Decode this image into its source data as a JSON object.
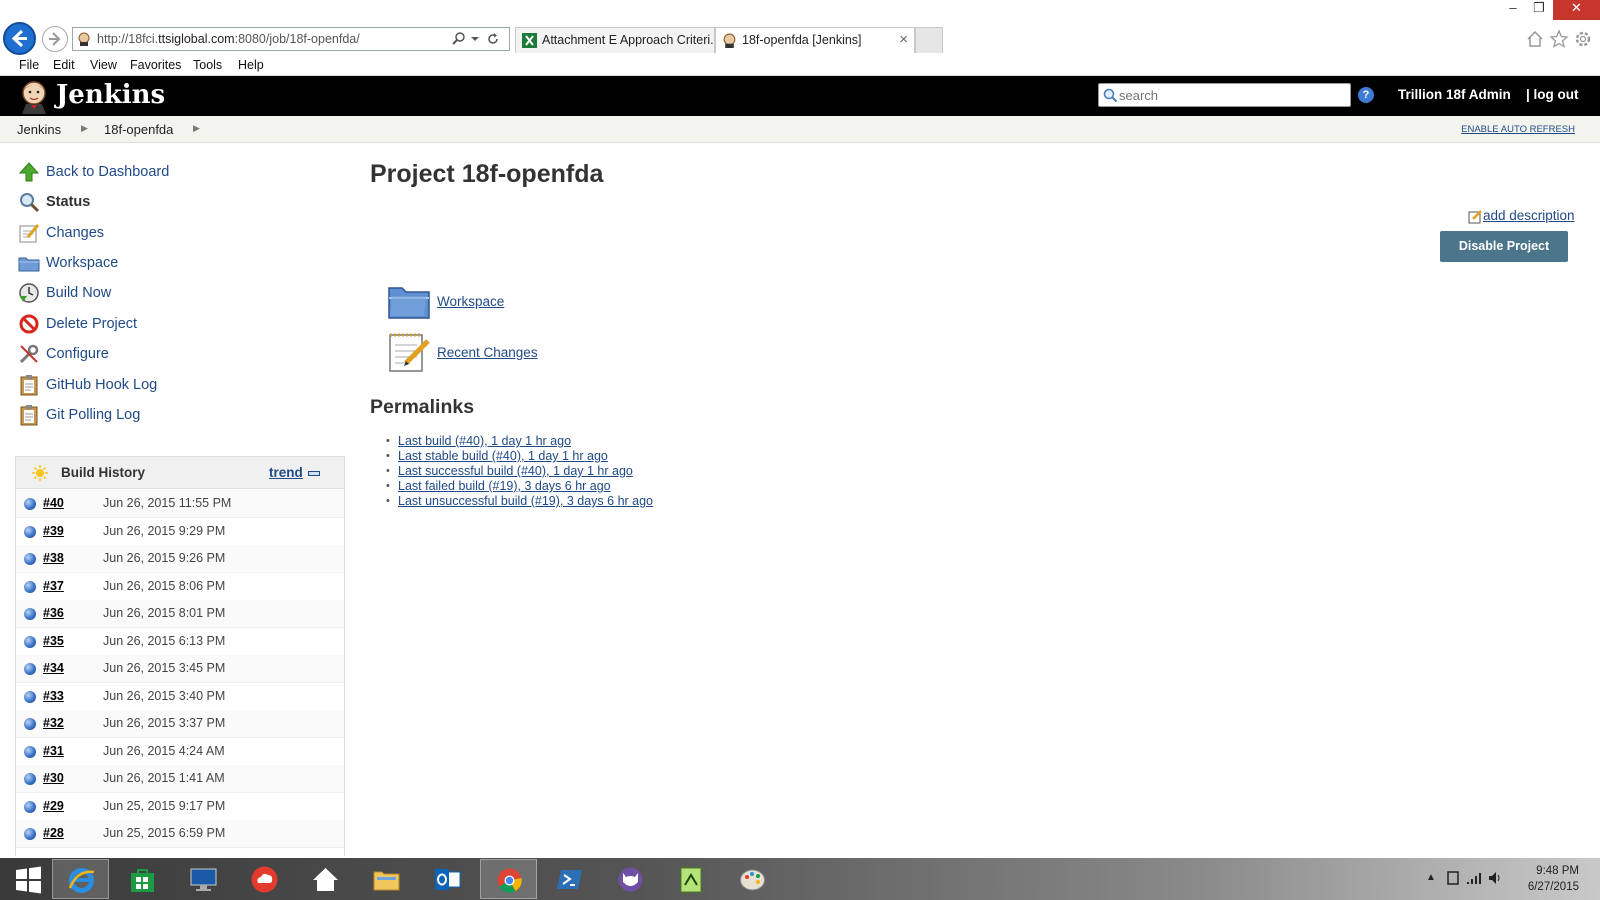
{
  "browser": {
    "url_prefix": "http://18fci.",
    "url_domain": "ttsiglobal.com",
    "url_suffix": ":8080/job/18f-openfda/",
    "tabs": [
      {
        "label": "Attachment E Approach Criteri..."
      },
      {
        "label": "18f-openfda [Jenkins]"
      }
    ],
    "menu": [
      "File",
      "Edit",
      "View",
      "Favorites",
      "Tools",
      "Help"
    ]
  },
  "header": {
    "logo_text": "Jenkins",
    "search_placeholder": "search",
    "user": "Trillion 18f Admin",
    "logout": "| log out"
  },
  "breadcrumb": {
    "items": [
      "Jenkins",
      "18f-openfda"
    ],
    "auto_refresh": "ENABLE AUTO REFRESH"
  },
  "sidebar": {
    "tasks": [
      {
        "label": "Back to Dashboard",
        "icon": "up-arrow-icon"
      },
      {
        "label": "Status",
        "icon": "magnifier-icon"
      },
      {
        "label": "Changes",
        "icon": "notepad-icon"
      },
      {
        "label": "Workspace",
        "icon": "folder-icon"
      },
      {
        "label": "Build Now",
        "icon": "clock-icon"
      },
      {
        "label": "Delete Project",
        "icon": "no-entry-icon"
      },
      {
        "label": "Configure",
        "icon": "wrench-icon"
      },
      {
        "label": "GitHub Hook Log",
        "icon": "clipboard-icon"
      },
      {
        "label": "Git Polling Log",
        "icon": "clipboard-icon"
      }
    ]
  },
  "build_history": {
    "title": "Build History",
    "trend": "trend",
    "builds": [
      {
        "num": "#40",
        "date": "Jun 26, 2015 11:55 PM"
      },
      {
        "num": "#39",
        "date": "Jun 26, 2015 9:29 PM"
      },
      {
        "num": "#38",
        "date": "Jun 26, 2015 9:26 PM"
      },
      {
        "num": "#37",
        "date": "Jun 26, 2015 8:06 PM"
      },
      {
        "num": "#36",
        "date": "Jun 26, 2015 8:01 PM"
      },
      {
        "num": "#35",
        "date": "Jun 26, 2015 6:13 PM"
      },
      {
        "num": "#34",
        "date": "Jun 26, 2015 3:45 PM"
      },
      {
        "num": "#33",
        "date": "Jun 26, 2015 3:40 PM"
      },
      {
        "num": "#32",
        "date": "Jun 26, 2015 3:37 PM"
      },
      {
        "num": "#31",
        "date": "Jun 26, 2015 4:24 AM"
      },
      {
        "num": "#30",
        "date": "Jun 26, 2015 1:41 AM"
      },
      {
        "num": "#29",
        "date": "Jun 25, 2015 9:17 PM"
      },
      {
        "num": "#28",
        "date": "Jun 25, 2015 6:59 PM"
      }
    ]
  },
  "main": {
    "title": "Project 18f-openfda",
    "add_description": "add description",
    "disable_button": "Disable Project",
    "links": [
      {
        "label": "Workspace",
        "icon": "folder-icon"
      },
      {
        "label": "Recent Changes",
        "icon": "notepad-icon"
      }
    ],
    "permalinks_title": "Permalinks",
    "permalinks": [
      "Last build (#40), 1 day 1 hr ago",
      "Last stable build (#40), 1 day 1 hr ago",
      "Last successful build (#40), 1 day 1 hr ago",
      "Last failed build (#19), 3 days 6 hr ago",
      "Last unsuccessful build (#19), 3 days 6 hr ago"
    ]
  },
  "taskbar": {
    "time": "9:48 PM",
    "date": "6/27/2015"
  },
  "colors": {
    "link": "#204a87",
    "header_bg": "#000000",
    "disable_button": "#4b758b",
    "build_ball": "#3b73c9"
  }
}
